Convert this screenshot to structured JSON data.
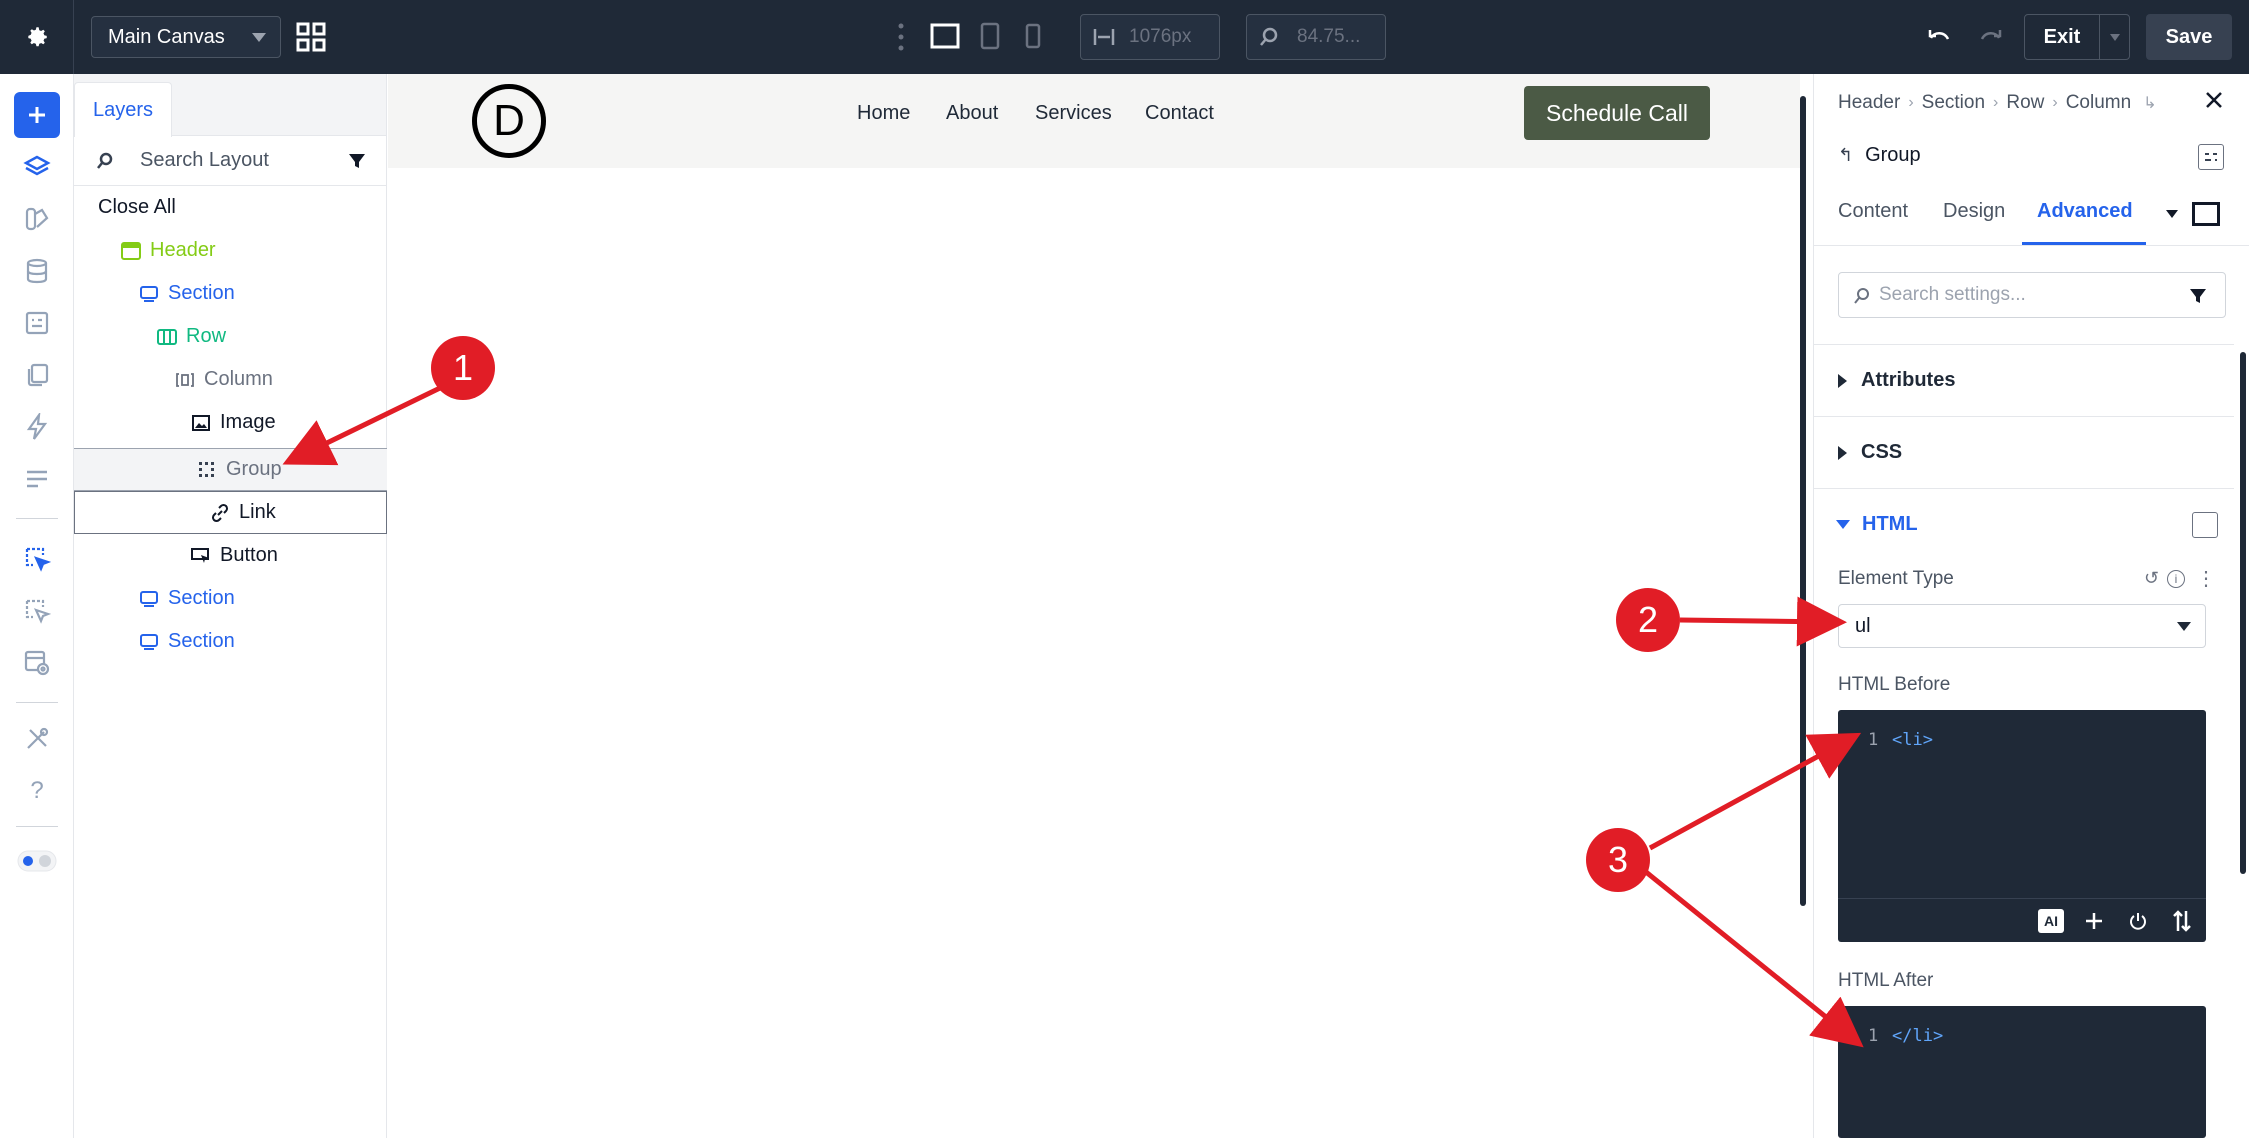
{
  "topbar": {
    "canvas_select": "Main Canvas",
    "width_value": "1076px",
    "zoom_value": "84.75...",
    "exit_label": "Exit",
    "save_label": "Save"
  },
  "layers": {
    "tab_label": "Layers",
    "search_placeholder": "Search Layout",
    "close_all": "Close All",
    "items": [
      {
        "label": "Header",
        "color": "#84cc16"
      },
      {
        "label": "Section",
        "color": "#2563eb"
      },
      {
        "label": "Row",
        "color": "#10b981"
      },
      {
        "label": "Column",
        "color": "#6b7280"
      },
      {
        "label": "Image",
        "color": "#111827"
      },
      {
        "label": "Group",
        "color": "#6b7280"
      },
      {
        "label": "Link",
        "color": "#111827"
      },
      {
        "label": "Button",
        "color": "#111827"
      },
      {
        "label": "Section",
        "color": "#2563eb"
      },
      {
        "label": "Section",
        "color": "#2563eb"
      }
    ]
  },
  "site": {
    "logo_letter": "D",
    "nav": [
      "Home",
      "About",
      "Services",
      "Contact"
    ],
    "cta": "Schedule Call"
  },
  "settings": {
    "breadcrumb": [
      "Header",
      "Section",
      "Row",
      "Column"
    ],
    "module_title": "Group",
    "tabs": [
      "Content",
      "Design",
      "Advanced"
    ],
    "active_tab": "Advanced",
    "search_placeholder": "Search settings...",
    "sections": {
      "attributes": "Attributes",
      "css": "CSS",
      "html": "HTML"
    },
    "element_type_label": "Element Type",
    "element_type_value": "ul",
    "html_before_label": "HTML Before",
    "html_before_line": "1",
    "html_before_code": "<li>",
    "html_after_label": "HTML After",
    "html_after_line": "1",
    "html_after_code": "</li>",
    "ai_label": "AI"
  },
  "annotations": [
    "1",
    "2",
    "3"
  ],
  "colors": {
    "accent": "#2563eb",
    "topbar": "#1f2937",
    "annotation": "#e11d26",
    "cta": "#4b5a45"
  }
}
